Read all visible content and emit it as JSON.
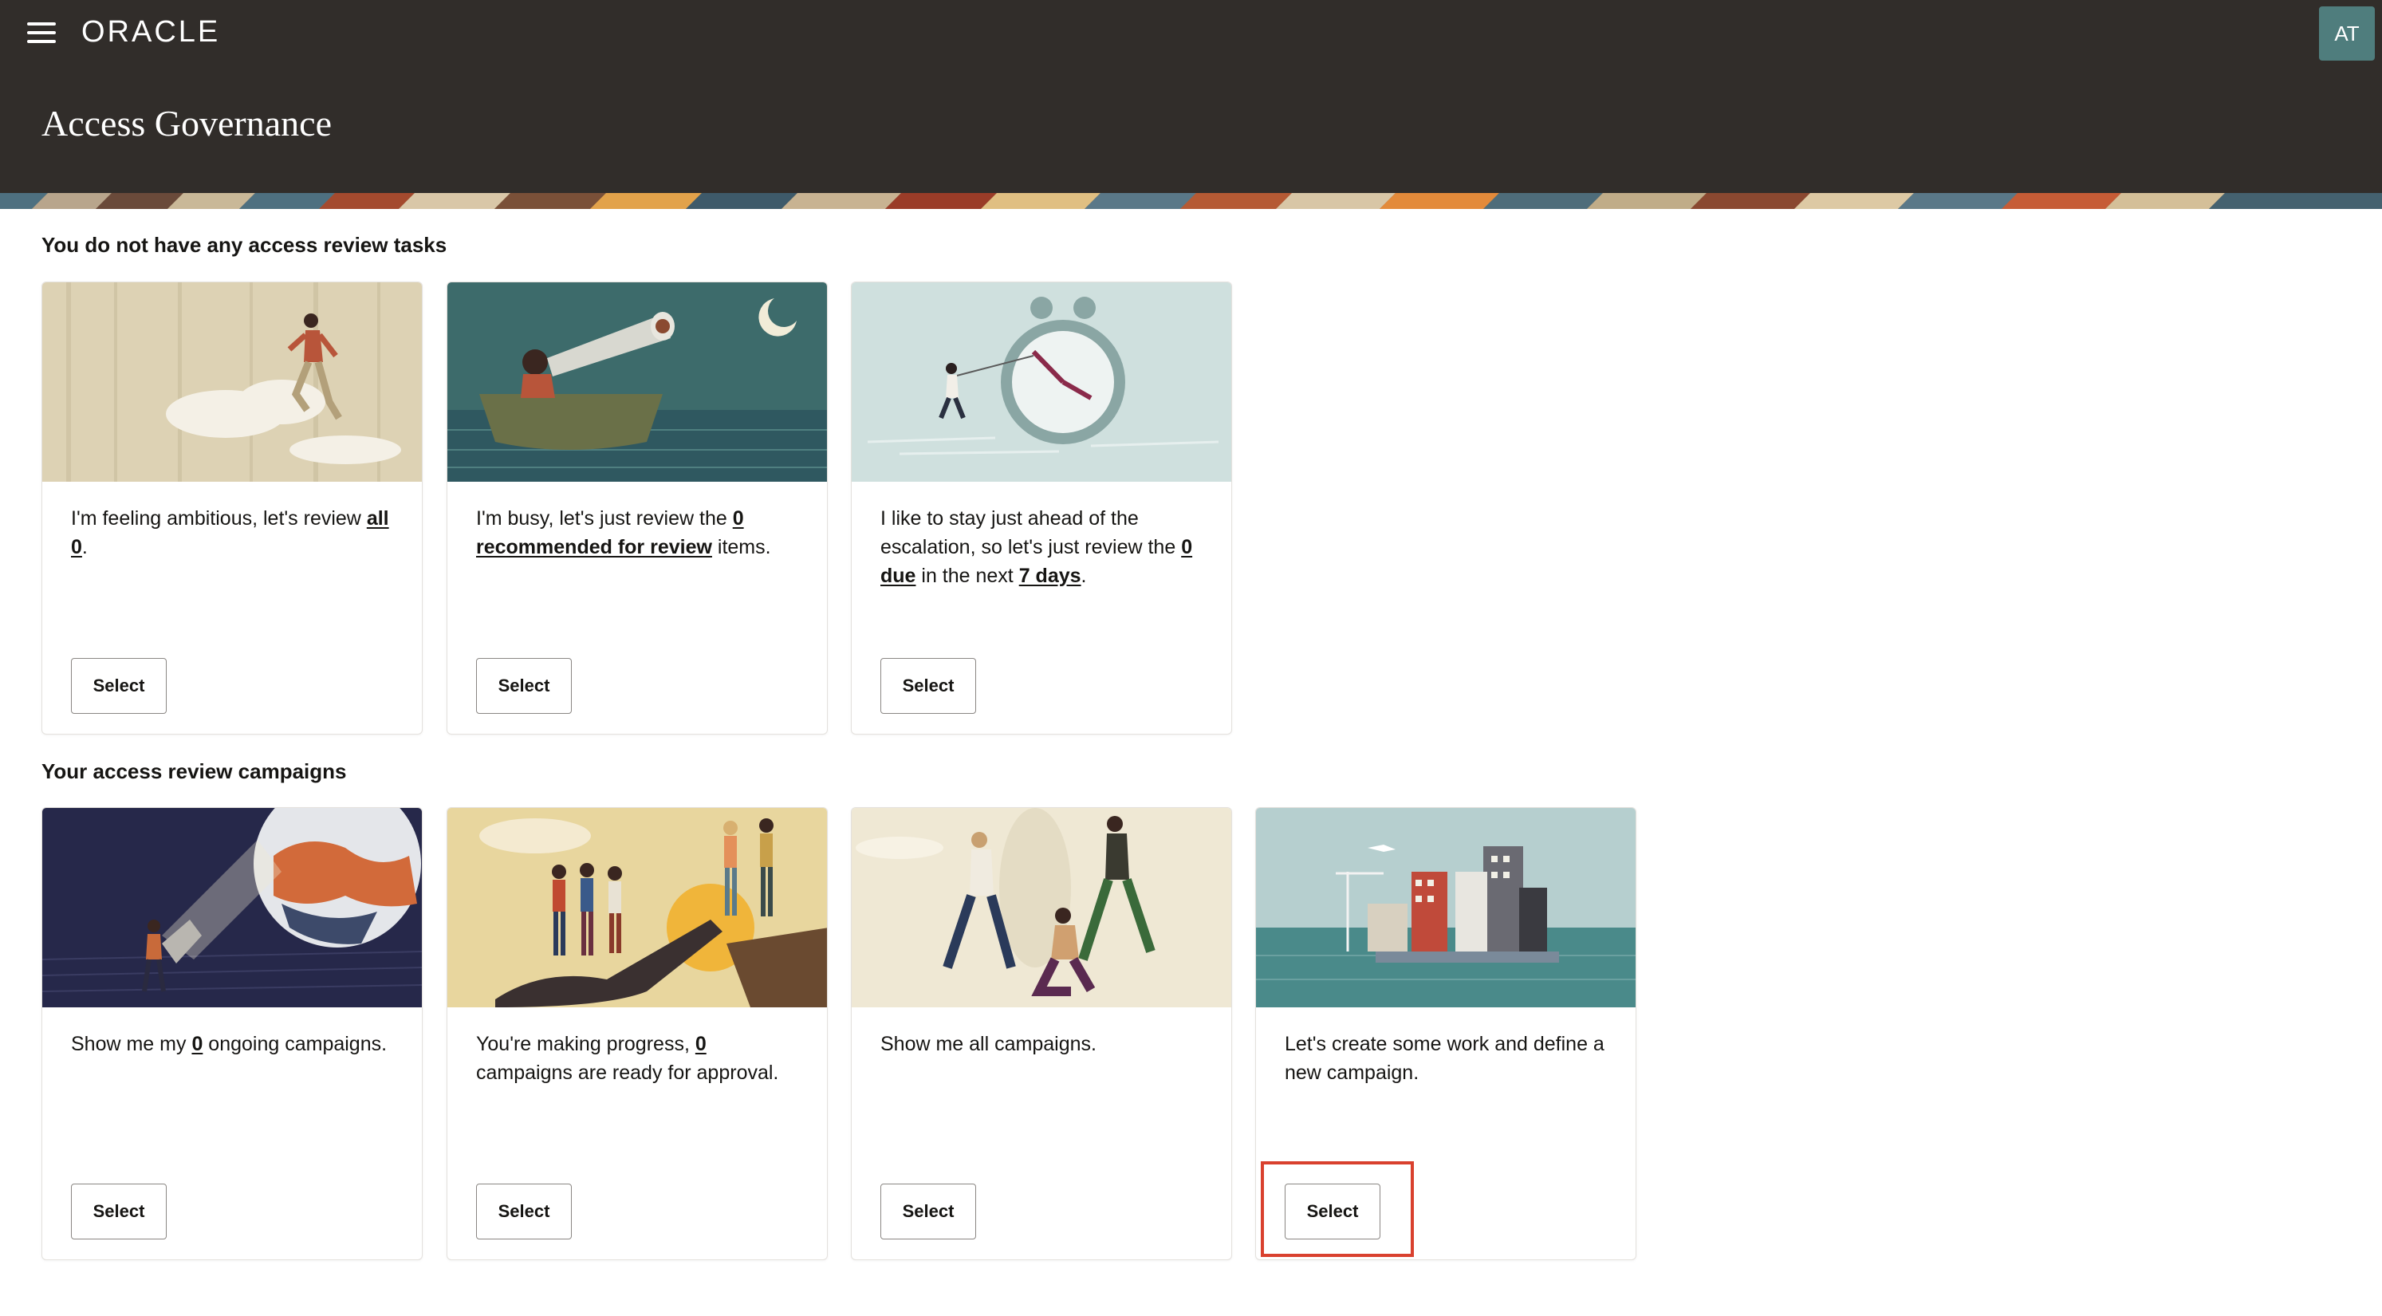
{
  "app": {
    "logo_text": "ORACLE",
    "avatar_initials": "AT",
    "page_title": "Access Governance"
  },
  "sections": {
    "tasks_heading": "You do not have any access review tasks",
    "campaigns_heading": "Your access review campaigns"
  },
  "cards": {
    "ambitious": {
      "pre": "I'm feeling ambitious, let's review ",
      "link": "all 0",
      "post": ".",
      "button": "Select"
    },
    "busy": {
      "pre": "I'm busy, let's just review the ",
      "link": "0 recommended for review",
      "post": " items.",
      "button": "Select"
    },
    "escalation": {
      "pre": "I like to stay just ahead of the escalation, so let's just review the ",
      "link1": "0 due",
      "mid": " in the next ",
      "link2": "7 days",
      "post": ".",
      "button": "Select"
    },
    "ongoing": {
      "pre": "Show me my ",
      "link": "0",
      "post": " ongoing campaigns.",
      "button": "Select"
    },
    "progress": {
      "pre": "You're making progress, ",
      "link": "0",
      "post": " campaigns are ready for approval.",
      "button": "Select"
    },
    "all_campaigns": {
      "text": "Show me all campaigns.",
      "button": "Select"
    },
    "create": {
      "text": "Let's create some work and define a new campaign.",
      "button": "Select"
    }
  },
  "colors": {
    "header_bg": "#312d2a",
    "avatar_bg": "#4f7d7d",
    "highlight": "#d9412e"
  }
}
